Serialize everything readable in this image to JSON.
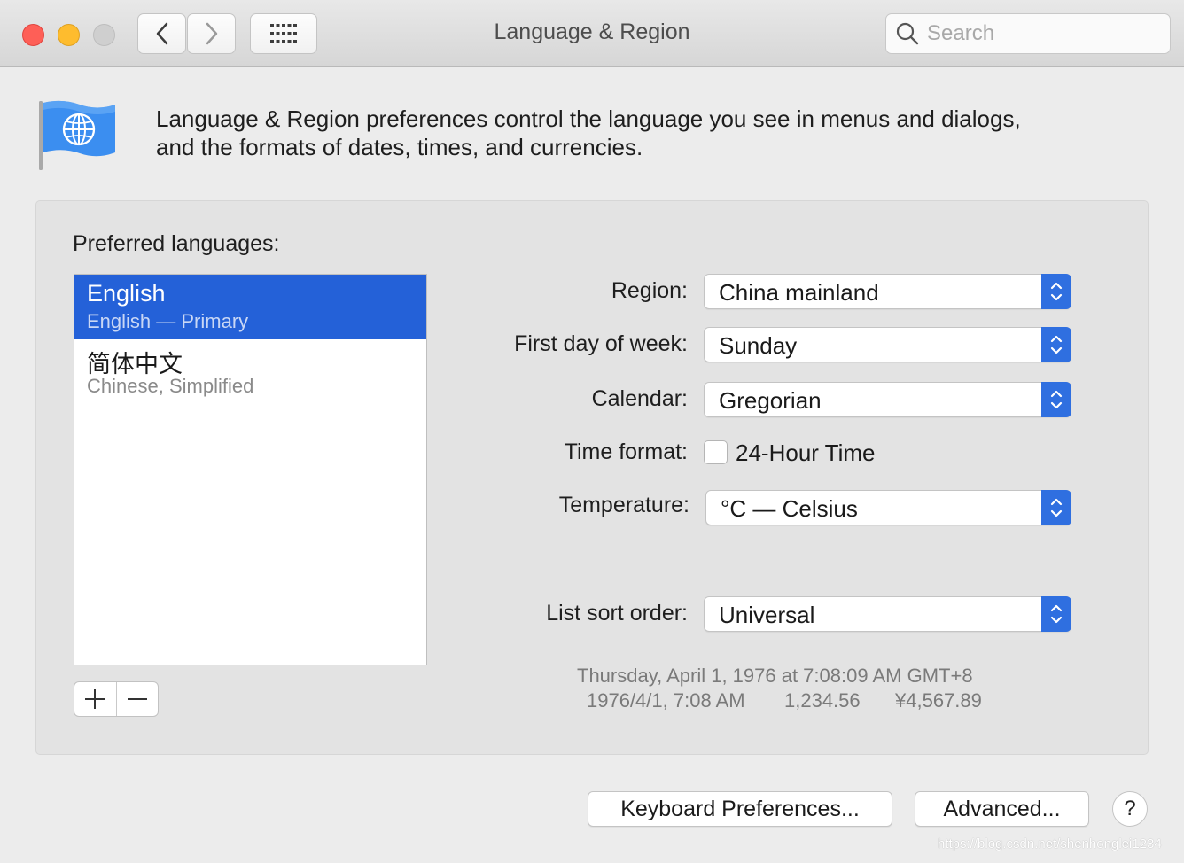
{
  "window": {
    "title": "Language & Region",
    "search_placeholder": "Search"
  },
  "intro": {
    "line1": "Language & Region preferences control the language you see in menus and dialogs,",
    "line2": "and the formats of dates, times, and currencies."
  },
  "languages": {
    "label": "Preferred languages:",
    "items": [
      {
        "name": "English",
        "sub": "English — Primary",
        "selected": true
      },
      {
        "name": "简体中文",
        "sub": "Chinese, Simplified",
        "selected": false
      }
    ],
    "add": "+",
    "remove": "—"
  },
  "settings": {
    "region": {
      "label": "Region:",
      "value": "China mainland"
    },
    "first_day": {
      "label": "First day of week:",
      "value": "Sunday"
    },
    "calendar": {
      "label": "Calendar:",
      "value": "Gregorian"
    },
    "time_format": {
      "label": "Time format:",
      "checkbox_label": "24-Hour Time",
      "checked": false
    },
    "temperature": {
      "label": "Temperature:",
      "value": "°C — Celsius"
    },
    "sort_order": {
      "label": "List sort order:",
      "value": "Universal"
    }
  },
  "sample": {
    "line1": "Thursday, April 1, 1976 at 7:08:09 AM GMT+8",
    "short_date": "1976/4/1, 7:08 AM",
    "number": "1,234.56",
    "currency": "¥4,567.89"
  },
  "buttons": {
    "keyboard": "Keyboard Preferences...",
    "advanced": "Advanced...",
    "help": "?"
  },
  "watermark": "https://blog.csdn.net/shenhonglei1234",
  "colors": {
    "accent": "#2461d8",
    "stepper": "#2f6fe0",
    "close": "#fe5f57",
    "minimize": "#febc2e"
  }
}
